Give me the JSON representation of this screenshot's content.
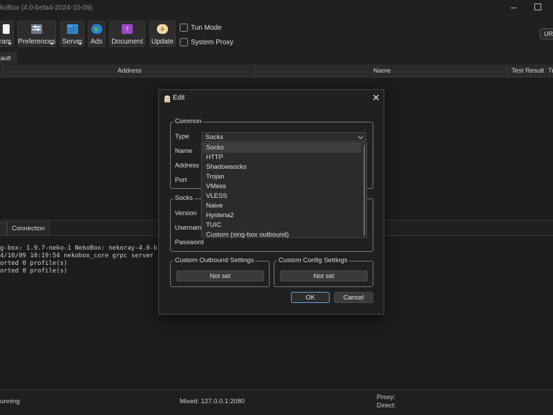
{
  "window": {
    "title": "koBox (4.0-beta4-2024-10-09)"
  },
  "toolbar": {
    "program_label": "ram",
    "preferences_label": "Preferences",
    "server_label": "Server",
    "ads_label": "Ads",
    "document_label": "Document",
    "update_label": "Update",
    "tun_mode_label": "Tun Mode",
    "system_proxy_label": "System Proxy",
    "url_label": "URL",
    "icons": {
      "program": "window-icon",
      "preferences": "sliders-icon",
      "server": "folder-icon",
      "ads": "globe-icon",
      "document": "document-icon",
      "update": "update-icon"
    }
  },
  "group_tab": {
    "label": "ault"
  },
  "table": {
    "headers": [
      "Address",
      "Name",
      "Test Result",
      "Tr"
    ]
  },
  "log": {
    "tabs": [
      "Connection"
    ],
    "lines": [
      "g-box: 1.9.7-neko-1 NekoBox: nekoray-4.0-b",
      "4/10/09 10:19:54 nekobox_core grpc server",
      "orted 0 profile(s)",
      "orted 0 profile(s)"
    ]
  },
  "status": {
    "running": "unning",
    "mixed": "Mixed: 127.0.0.1:2080",
    "proxy": "Proxy:",
    "direct": "Direct:"
  },
  "dialog": {
    "title": "Edit",
    "common": {
      "title": "Common",
      "type_label": "Type",
      "type_value": "Socks",
      "name_label": "Name",
      "address_label": "Address",
      "port_label": "Port"
    },
    "type_options": [
      "Socks",
      "HTTP",
      "Shadowsocks",
      "Trojan",
      "VMess",
      "VLESS",
      "Naive",
      "Hysteria2",
      "TUIC",
      "Custom (sing-box outbound)"
    ],
    "socks": {
      "title": "Socks",
      "version_label": "Version",
      "username_label": "Username",
      "password_label": "Password"
    },
    "custom_outbound": {
      "title": "Custom Outbound Settings",
      "button": "Not set"
    },
    "custom_config": {
      "title": "Custom Config Settings",
      "button": "Not set"
    },
    "ok_label": "OK",
    "cancel_label": "Cancel"
  },
  "colors": {
    "background": "#202020",
    "accent": "#60a5e8",
    "dialog_border": "#4a4a4a"
  }
}
